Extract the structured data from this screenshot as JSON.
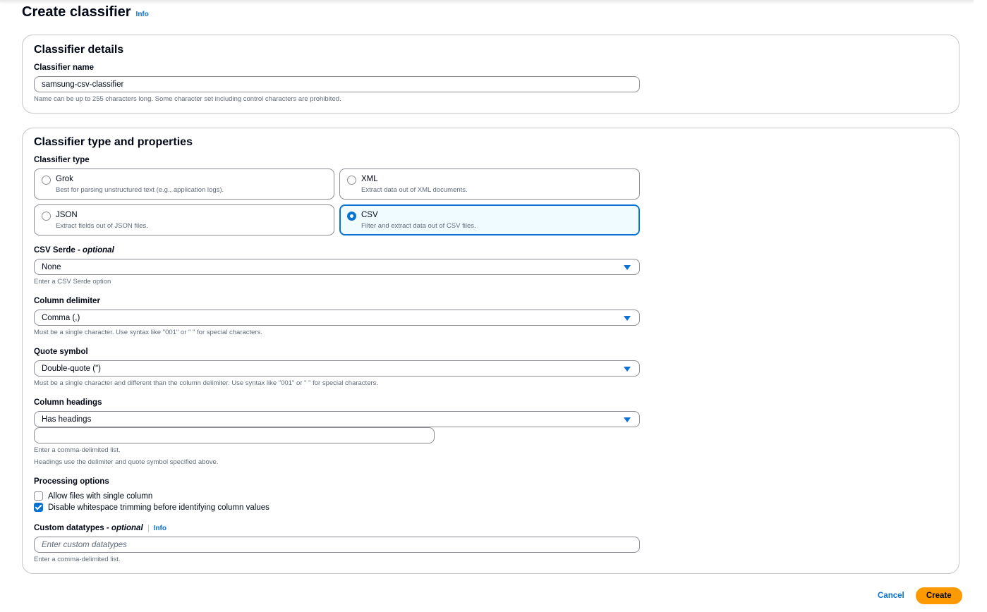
{
  "page": {
    "title": "Create classifier",
    "info_label": "Info"
  },
  "details": {
    "title": "Classifier details",
    "name_label": "Classifier name",
    "name_value": "samsung-csv-classifier",
    "name_hint": "Name can be up to 255 characters long. Some character set including control characters are prohibited."
  },
  "props": {
    "title": "Classifier type and properties",
    "type_label": "Classifier type",
    "types": [
      {
        "title": "Grok",
        "desc": "Best for parsing unstructured text (e.g., application logs).",
        "selected": false
      },
      {
        "title": "XML",
        "desc": "Extract data out of XML documents.",
        "selected": false
      },
      {
        "title": "JSON",
        "desc": "Extract fields out of JSON files.",
        "selected": false
      },
      {
        "title": "CSV",
        "desc": "Filter and extract data out of CSV files.",
        "selected": true
      }
    ],
    "serde": {
      "label": "CSV Serde",
      "optional": "optional",
      "value": "None",
      "hint": "Enter a CSV Serde option"
    },
    "delimiter": {
      "label": "Column delimiter",
      "value": "Comma (,)",
      "hint": "Must be a single character. Use syntax like \"001\" or \" \" for special characters."
    },
    "quote": {
      "label": "Quote symbol",
      "value": "Double-quote (\")",
      "hint": "Must be a single character and different than the column delimiter. Use syntax like \"001\" or \" \" for special characters."
    },
    "headings": {
      "label": "Column headings",
      "value": "Has headings",
      "list_value": "",
      "hint1": "Enter a comma-delimited list.",
      "hint2": "Headings use the delimiter and quote symbol specified above."
    },
    "processing": {
      "label": "Processing options",
      "options": [
        {
          "label": "Allow files with single column",
          "checked": false
        },
        {
          "label": "Disable whitespace trimming before identifying column values",
          "checked": true
        }
      ]
    },
    "datatypes": {
      "label": "Custom datatypes",
      "optional": "optional",
      "info_label": "Info",
      "placeholder": "Enter custom datatypes",
      "hint": "Enter a comma-delimited list."
    }
  },
  "actions": {
    "cancel": "Cancel",
    "create": "Create"
  },
  "colors": {
    "accent": "#0972d3",
    "primary_button": "#ff9900",
    "selected_tile_bg": "#f0fbff"
  },
  "icons": {
    "select_caret": "caret-down-icon",
    "radio": "radio-icon",
    "checkbox": "checkbox-icon"
  }
}
